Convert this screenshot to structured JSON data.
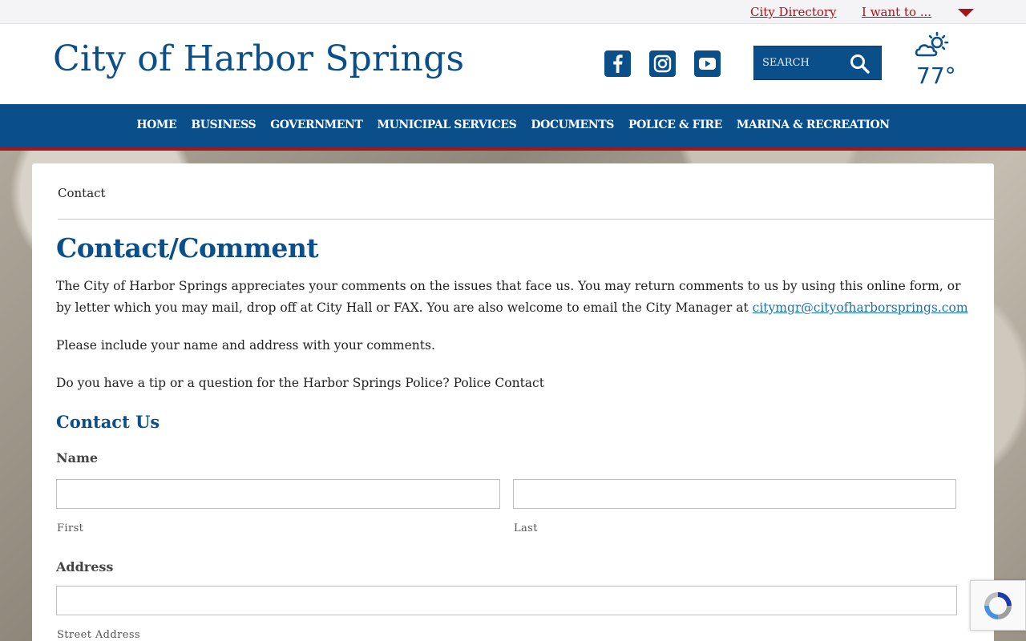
{
  "topbar": {
    "city_directory": "City Directory",
    "i_want_to": "I want to ..."
  },
  "header": {
    "site_title": "City of Harbor Springs",
    "search_placeholder": "SEARCH",
    "weather_temp": "77°"
  },
  "social_icons": [
    "facebook-icon",
    "instagram-icon",
    "youtube-icon"
  ],
  "nav": {
    "items": [
      "HOME",
      "BUSINESS",
      "GOVERNMENT",
      "MUNICIPAL SERVICES",
      "DOCUMENTS",
      "POLICE & FIRE",
      "MARINA & RECREATION"
    ]
  },
  "content": {
    "breadcrumb": "Contact",
    "page_title": "Contact/Comment",
    "intro": "The City of Harbor Springs appreciates your comments on the issues that face us. You may return comments to us by using this online form, or by letter which you may mail, drop off at City Hall or FAX. You are also welcome to email the City Manager at ",
    "email": "citymgr@cityofharborsprings.com",
    "include_note": "Please include your name and address with your comments.",
    "police_note": "Do you have a tip or a question for the Harbor Springs Police? Police Contact"
  },
  "form": {
    "section_title": "Contact Us",
    "name_label": "Name",
    "first_label": "First",
    "last_label": "Last",
    "address_label": "Address",
    "street_label": "Street Address"
  },
  "colors": {
    "brand_blue": "#0a4f8a",
    "accent_red": "#9a1b1f",
    "link_red": "#a3141b",
    "link_blue": "#1a73b8"
  }
}
